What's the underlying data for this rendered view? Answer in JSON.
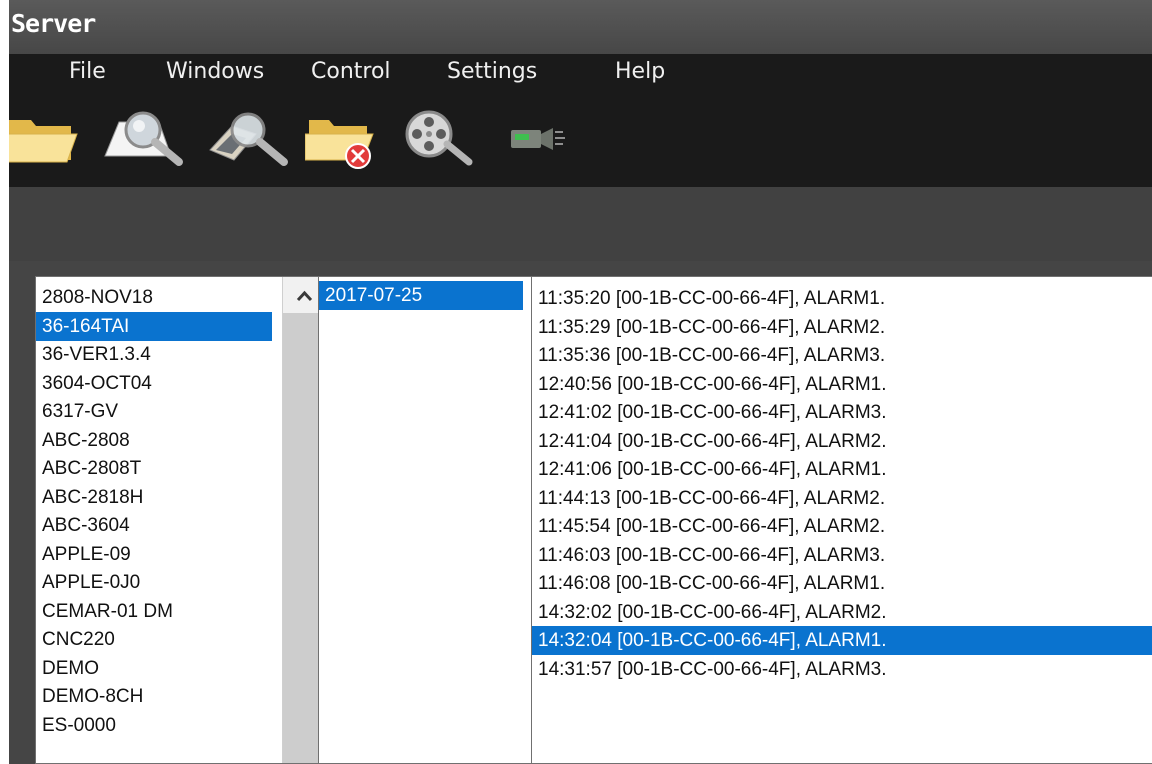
{
  "window": {
    "title": "Server"
  },
  "menu": {
    "items": [
      {
        "label": "File"
      },
      {
        "label": "Windows"
      },
      {
        "label": "Control"
      },
      {
        "label": "Settings"
      },
      {
        "label": "Help"
      }
    ]
  },
  "toolbar": {
    "icons": [
      "open-folder-icon",
      "search-icon",
      "search-playback-icon",
      "folder-delete-icon",
      "film-reel-search-icon",
      "camera-icon"
    ]
  },
  "device_list": {
    "items": [
      "2808-NOV18",
      "36-164TAI",
      "36-VER1.3.4",
      "3604-OCT04",
      "6317-GV",
      "ABC-2808",
      "ABC-2808T",
      "ABC-2818H",
      "ABC-3604",
      "APPLE-09",
      "APPLE-0J0",
      "CEMAR-01 DM",
      "CNC220",
      "DEMO",
      "DEMO-8CH",
      "ES-0000"
    ],
    "selected": "36-164TAI"
  },
  "date_list": {
    "items": [
      "2017-07-25"
    ],
    "selected": "2017-07-25"
  },
  "event_log": {
    "items": [
      "11:35:20 [00-1B-CC-00-66-4F], ALARM1.",
      "11:35:29 [00-1B-CC-00-66-4F], ALARM2.",
      "11:35:36 [00-1B-CC-00-66-4F], ALARM3.",
      "12:40:56 [00-1B-CC-00-66-4F], ALARM1.",
      "12:41:02 [00-1B-CC-00-66-4F], ALARM3.",
      "12:41:04 [00-1B-CC-00-66-4F], ALARM2.",
      "12:41:06 [00-1B-CC-00-66-4F], ALARM1.",
      "11:44:13 [00-1B-CC-00-66-4F], ALARM2.",
      "11:45:54 [00-1B-CC-00-66-4F], ALARM2.",
      "11:46:03 [00-1B-CC-00-66-4F], ALARM3.",
      "11:46:08 [00-1B-CC-00-66-4F], ALARM1.",
      "14:32:02 [00-1B-CC-00-66-4F], ALARM2.",
      "14:32:04 [00-1B-CC-00-66-4F], ALARM1.",
      "14:31:57 [00-1B-CC-00-66-4F], ALARM3."
    ],
    "selected": "14:32:04 [00-1B-CC-00-66-4F], ALARM1."
  },
  "colors": {
    "selection": "#0a73cf",
    "menubar": "#1a1a1a",
    "titlebar": "#474747",
    "folder": "#f5d76e"
  }
}
